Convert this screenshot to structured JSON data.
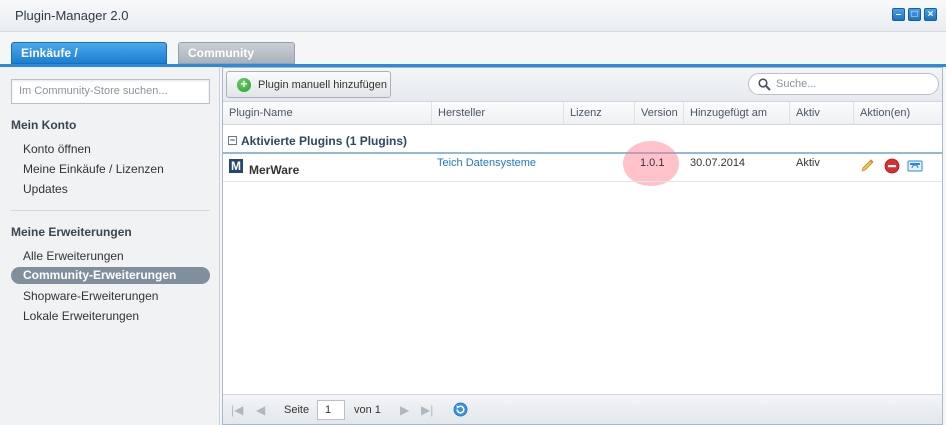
{
  "window": {
    "title": "Plugin-Manager 2.0"
  },
  "tabs": [
    {
      "label": "Einkäufe / Erweiterungen"
    },
    {
      "label": "Community Store"
    }
  ],
  "sidebar": {
    "search_placeholder": "Im Community-Store suchen...",
    "section1": {
      "title": "Mein Konto",
      "items": [
        "Konto öffnen",
        "Meine Einkäufe / Lizenzen",
        "Updates"
      ]
    },
    "section2": {
      "title": "Meine Erweiterungen",
      "items": [
        "Alle Erweiterungen",
        "Community-Erweiterungen",
        "Shopware-Erweiterungen",
        "Lokale Erweiterungen"
      ],
      "selected_index": 1
    }
  },
  "toolbar": {
    "add_label": "Plugin manuell hinzufügen",
    "search_placeholder": "Suche..."
  },
  "grid": {
    "columns": [
      "Plugin-Name",
      "Hersteller",
      "Lizenz",
      "Version",
      "Hinzugefügt am",
      "Aktiv",
      "Aktion(en)"
    ],
    "group_title": "Aktivierte Plugins (1 Plugins)",
    "rows": [
      {
        "logo": "M",
        "name": "MerWare",
        "manufacturer": "Teich Datensysteme",
        "license": "",
        "version": "1.0.1",
        "added": "30.07.2014",
        "active": "Aktiv",
        "actions": [
          "edit-icon",
          "delete-icon",
          "update-icon"
        ]
      }
    ]
  },
  "pager": {
    "page_label": "Seite",
    "page_value": "1",
    "of_label": "von 1"
  },
  "colors": {
    "accent": "#2b8ad9",
    "selected_bg": "#7f8f9e",
    "link": "#1e7ac4",
    "highlight": "#ff788c"
  }
}
